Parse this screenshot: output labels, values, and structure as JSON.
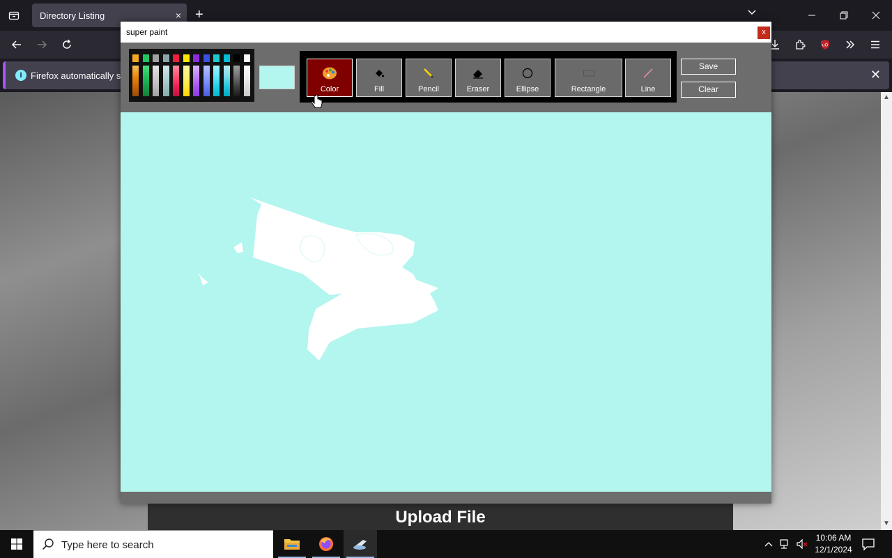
{
  "browser": {
    "tab_title": "Directory Listing",
    "tab_close": "×",
    "new_tab": "+",
    "notification": "Firefox automatically sen",
    "notification_close": "✕"
  },
  "page": {
    "upload_title": "Upload File"
  },
  "paint": {
    "title": "super paint",
    "close": "x",
    "selected_color": "#b3f5ef",
    "canvas_color": "#b3f5ef",
    "palette": [
      {
        "top": "#f5a623",
        "strip": [
          "#f8c35a",
          "#e98b12",
          "#c9670b",
          "#9a4d07"
        ]
      },
      {
        "top": "#22c55e",
        "strip": [
          "#4ade80",
          "#22c55e",
          "#16a34a",
          "#15803d"
        ]
      },
      {
        "top": "#a0a0a0",
        "strip": [
          "#e5e5e5",
          "#cfcfcf",
          "#bdbdbd",
          "#a0a0a0"
        ]
      },
      {
        "top": "#8aa6a6",
        "strip": [
          "#d0e8e8",
          "#b8d6d6",
          "#9fc2c2",
          "#87acac"
        ]
      },
      {
        "top": "#ef1e3c",
        "strip": [
          "#ff8aa0",
          "#ff5577",
          "#ef1e55",
          "#c41040"
        ]
      },
      {
        "top": "#ffe600",
        "strip": [
          "#fff59d",
          "#fff176",
          "#ffeb3b",
          "#fbd300"
        ]
      },
      {
        "top": "#8a2be2",
        "strip": [
          "#d8b4fe",
          "#c084fc",
          "#a855f7",
          "#8b3be0"
        ]
      },
      {
        "top": "#3b4fe0",
        "strip": [
          "#b4c0ff",
          "#93a3ff",
          "#6b80f5",
          "#4a5ee0"
        ]
      },
      {
        "top": "#1ec8c8",
        "strip": [
          "#a5f3fc",
          "#67e8f9",
          "#22d3ee",
          "#06b6d4"
        ]
      },
      {
        "top": "#00bcd4",
        "strip": [
          "#b2ebf2",
          "#80deea",
          "#26c6da",
          "#00acc1"
        ]
      },
      {
        "top": "#000000",
        "strip": [
          "#9e9e9e",
          "#757575",
          "#424242",
          "#1a1a1a"
        ]
      },
      {
        "top": "#ffffff",
        "strip": [
          "#ffffff",
          "#f0f0f0",
          "#dcdcdc",
          "#c8c8c8"
        ]
      }
    ],
    "tools": [
      {
        "name": "color",
        "label": "Color",
        "icon": "palette-icon",
        "active": true
      },
      {
        "name": "fill",
        "label": "Fill",
        "icon": "paint-bucket-icon",
        "active": false
      },
      {
        "name": "pencil",
        "label": "Pencil",
        "icon": "pencil-icon",
        "active": false
      },
      {
        "name": "eraser",
        "label": "Eraser",
        "icon": "eraser-icon",
        "active": false
      },
      {
        "name": "ellipse",
        "label": "Ellipse",
        "icon": "ellipse-icon",
        "active": false
      },
      {
        "name": "rectangle",
        "label": "Rectangle",
        "icon": "rectangle-icon",
        "active": false
      },
      {
        "name": "line",
        "label": "Line",
        "icon": "line-icon",
        "active": false
      }
    ],
    "save_label": "Save",
    "clear_label": "Clear"
  },
  "taskbar": {
    "search_placeholder": "Type here to search",
    "time": "10:06 AM",
    "date": "12/1/2024"
  }
}
